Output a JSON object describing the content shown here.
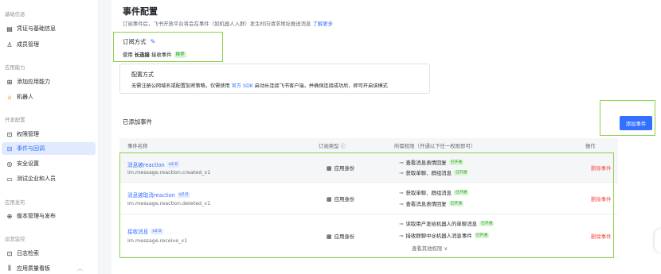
{
  "sidebar": {
    "groups": [
      {
        "label": "基础信息",
        "items": [
          {
            "label": "凭证与基础信息",
            "icon": "credential-icon"
          },
          {
            "label": "成员管理",
            "icon": "user-icon"
          }
        ]
      },
      {
        "label": "应用能力",
        "items": [
          {
            "label": "添加应用能力",
            "icon": "grid-add-icon"
          },
          {
            "label": "机器人",
            "icon": "robot-icon"
          }
        ]
      },
      {
        "label": "开发配置",
        "items": [
          {
            "label": "权限管理",
            "icon": "lock-icon"
          },
          {
            "label": "事件与回调",
            "icon": "event-icon",
            "active": true
          },
          {
            "label": "安全设置",
            "icon": "shield-icon"
          },
          {
            "label": "测试企业和人员",
            "icon": "test-icon"
          }
        ]
      },
      {
        "label": "应用发布",
        "items": [
          {
            "label": "版本管理与发布",
            "icon": "version-icon"
          }
        ]
      },
      {
        "label": "运营监控",
        "items": [
          {
            "label": "日志检索",
            "icon": "log-icon"
          },
          {
            "label": "应用质量看板",
            "icon": "chart-icon"
          }
        ]
      }
    ]
  },
  "header": {
    "title": "事件配置",
    "description": "订阅事件后，飞书开放平台将会在事件（如机器人入群）发生时向请求地址推送消息",
    "learn_more": "了解更多"
  },
  "subscription": {
    "label": "订阅方式",
    "prefix": "使用",
    "mode": "长连接",
    "suffix": "接收事件",
    "recommended": "推荐"
  },
  "config": {
    "title": "配置方式",
    "text_before": "无需注册公网域名或配置加密策略，仅需使用",
    "sdk_link": "官方 SDK",
    "text_after": "启动长连接飞书客户端，并确保连接成功后，即可开启该模式"
  },
  "added": {
    "label": "已添加事件",
    "add_button": "添加事件"
  },
  "table": {
    "columns": [
      "事件名称",
      "订阅类型 ⓘ",
      "所需权限（开通以下任一权限即可）",
      "操作"
    ],
    "rows": [
      {
        "name": "消息被reaction",
        "version": "v2.0",
        "code": "im.message.reaction.created_v1",
        "sub_type": "应用身份",
        "permissions": [
          {
            "label": "查看消息表情回复",
            "status": "已开通"
          },
          {
            "label": "获取单聊、群组消息",
            "status": "已开通"
          }
        ],
        "action": "删除事件"
      },
      {
        "name": "消息被取消reaction",
        "version": "v2.0",
        "code": "im.message.reaction.deleted_v1",
        "sub_type": "应用身份",
        "permissions": [
          {
            "label": "获取单聊、群组消息",
            "status": "已开通"
          },
          {
            "label": "查看消息表情回复",
            "status": "已开通"
          }
        ],
        "action": "删除事件"
      },
      {
        "name": "接收消息",
        "version": "v2.0",
        "code": "im.message.receive_v1",
        "sub_type": "应用身份",
        "permissions": [
          {
            "label": "读取用户发给机器人的单聊消息",
            "status": "已开通"
          },
          {
            "label": "接收群聊中@机器人消息事件",
            "status": "已开通"
          }
        ],
        "more_permissions": "查看其他权限 ∨",
        "action": "删除事件"
      }
    ]
  },
  "colors": {
    "accent": "#3370ff",
    "danger": "#f54a45",
    "highlight_border": "#8fd14f",
    "success_tag": "#2ea121"
  }
}
